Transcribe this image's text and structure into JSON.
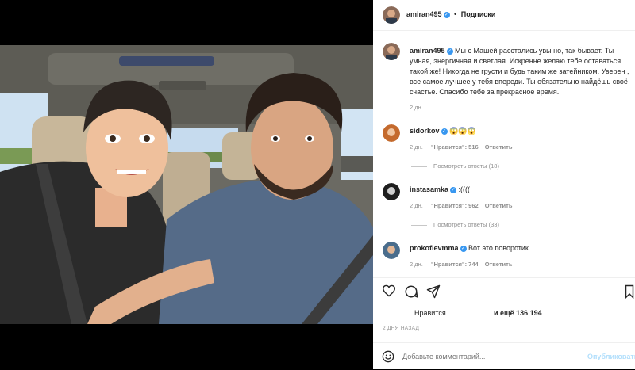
{
  "post": {
    "author": "amiran495",
    "follow_label": "Подписки",
    "separator": "•"
  },
  "caption": {
    "author": "amiran495",
    "text": "Мы с Машей расстались увы но, так бывает. Ты умная, энергичная и светлая. Искренне желаю тебе оставаться такой же! Никогда не грусти и будь таким же затейником. Уверен , все самое лучшее у тебя впереди. Ты обязательно найдёшь своё счастье. Спасибо тебе за прекрасное время.",
    "time": "2 дн."
  },
  "comments": [
    {
      "user": "sidorkov",
      "text": "😱😱😱",
      "time": "2 дн.",
      "likes": "\"Нравится\": 516",
      "reply": "Ответить",
      "view_replies": "Посмотреть ответы (18)"
    },
    {
      "user": "instasamka",
      "text": ":((((",
      "time": "2 дн.",
      "likes": "\"Нравится\": 962",
      "reply": "Ответить",
      "view_replies": "Посмотреть ответы (33)"
    },
    {
      "user": "prokofievmma",
      "text": "Вот это поворотик...",
      "time": "2 дн.",
      "likes": "\"Нравится\": 744",
      "reply": "Ответить"
    }
  ],
  "likes_line": {
    "liked_by": "Нравится",
    "and_more": "и ещё 136 194"
  },
  "timestamp": "2 ДНЯ НАЗАД",
  "add_comment": {
    "placeholder": "Добавьте комментарий...",
    "publish_label": "Опубликовать"
  },
  "icons": [
    "smiley-icon",
    "heart-icon",
    "comment-icon",
    "share-icon",
    "bookmark-icon",
    "verified-icon"
  ],
  "colors": {
    "verified": "#3897f0",
    "link": "#b2dffc",
    "meta": "#8e8e8e"
  }
}
